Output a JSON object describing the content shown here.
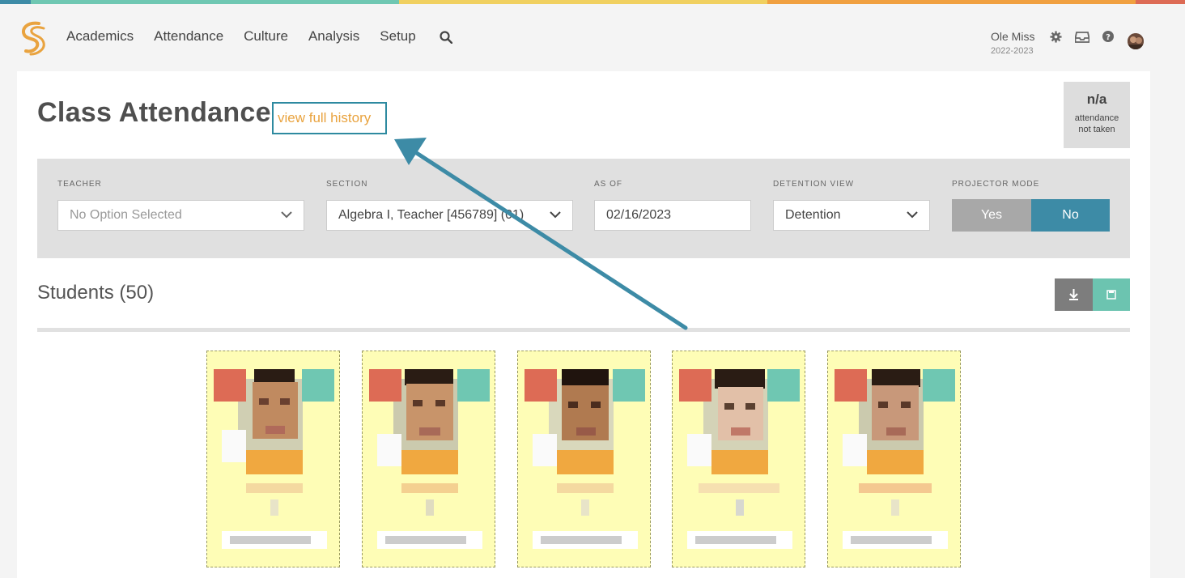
{
  "brand": {
    "accent": "#e9a33f",
    "teal": "#3d8ba6",
    "mint": "#6fc7b2",
    "red": "#dd6b55",
    "strip": [
      "#3d8ba6",
      "#6fc7b2",
      "#f0d060",
      "#f0a040",
      "#dd6b55"
    ]
  },
  "nav": {
    "items": [
      "Academics",
      "Attendance",
      "Culture",
      "Analysis",
      "Setup"
    ],
    "search_icon": "search-icon",
    "school_name": "Ole Miss",
    "school_year": "2022-2023"
  },
  "page": {
    "title": "Class Attendance",
    "history_link": "view full history",
    "badge_value": "n/a",
    "badge_label_1": "attendance",
    "badge_label_2": "not taken"
  },
  "filters": {
    "teacher_label": "TEACHER",
    "teacher_value": "No Option Selected",
    "section_label": "SECTION",
    "section_value": "Algebra I, Teacher [456789] (01)",
    "asof_label": "AS OF",
    "asof_value": "02/16/2023",
    "detention_label": "DETENTION VIEW",
    "detention_value": "Detention",
    "projector_label": "PROJECTOR MODE",
    "projector_yes": "Yes",
    "projector_no": "No"
  },
  "students": {
    "title": "Students (50)",
    "download_icon": "download-icon",
    "save_icon": "save-icon"
  }
}
